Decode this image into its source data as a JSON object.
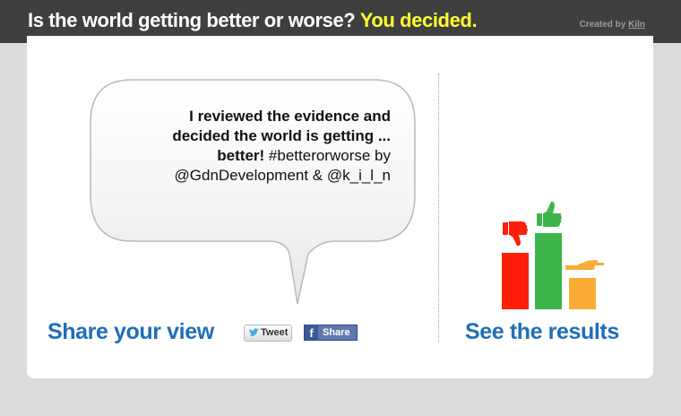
{
  "header": {
    "title": "Is the world getting better or worse?",
    "decided": "You decided.",
    "credit_prefix": "Created by",
    "credit_name": "Kiln"
  },
  "bubble": {
    "line1": "I reviewed the evidence and",
    "line2": "decided the world is getting ...",
    "line3_bold": "better!",
    "line3_rest": " #betterorworse by",
    "line4": "@GdnDevelopment & @k_i_l_n"
  },
  "share": {
    "label": "Share your view",
    "tweet_label": "Tweet",
    "facebook_label": "Share"
  },
  "results": {
    "label": "See the results",
    "icons": [
      "thumbs-down-icon",
      "thumbs-up-icon",
      "thumbs-sideways-icon"
    ]
  },
  "colors": {
    "header_bg": "#3f3f3f",
    "decided_text": "#ffff33",
    "link_blue": "#1f6eb8",
    "bar_worse": "#ff1e0a",
    "bar_better": "#3db54a",
    "bar_same": "#fbac36"
  }
}
